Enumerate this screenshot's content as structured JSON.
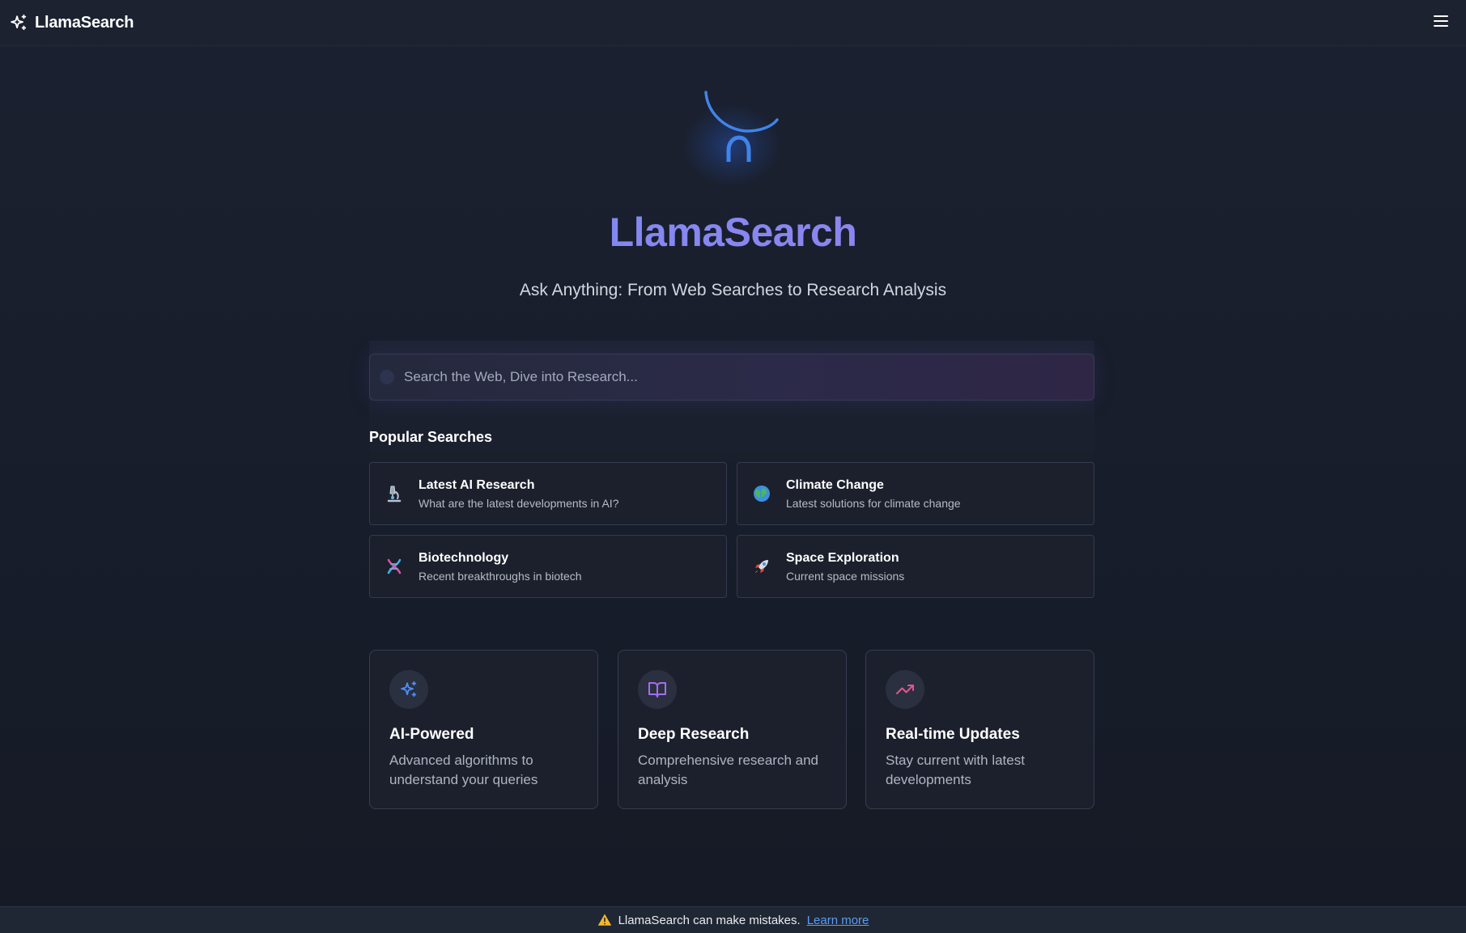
{
  "header": {
    "brand": "LlamaSearch",
    "brand_icon": "sparkles-icon",
    "menu_icon": "hamburger-menu-icon"
  },
  "hero": {
    "title": "LlamaSearch",
    "subtitle": "Ask Anything: From Web Searches to Research Analysis",
    "logo_icon": "llama-arc-logo"
  },
  "search": {
    "placeholder": "Search the Web, Dive into Research...",
    "value": ""
  },
  "popular": {
    "title": "Popular Searches",
    "items": [
      {
        "icon": "microscope-icon",
        "title": "Latest AI Research",
        "desc": "What are the latest developments in AI?"
      },
      {
        "icon": "globe-icon",
        "title": "Climate Change",
        "desc": "Latest solutions for climate change"
      },
      {
        "icon": "dna-icon",
        "title": "Biotechnology",
        "desc": "Recent breakthroughs in biotech"
      },
      {
        "icon": "rocket-icon",
        "title": "Space Exploration",
        "desc": "Current space missions"
      }
    ]
  },
  "features": [
    {
      "icon": "sparkles-icon",
      "title": "AI-Powered",
      "desc": "Advanced algorithms to understand your queries",
      "color": "#4f8ef7"
    },
    {
      "icon": "book-open-icon",
      "title": "Deep Research",
      "desc": "Comprehensive research and analysis",
      "color": "#a66cf0"
    },
    {
      "icon": "trending-up-icon",
      "title": "Real-time Updates",
      "desc": "Stay current with latest developments",
      "color": "#e8538f"
    }
  ],
  "footer": {
    "warning_icon": "warning-icon",
    "text": "LlamaSearch can make mistakes.",
    "link": "Learn more"
  },
  "colors": {
    "background": "#171c28",
    "accent_blue": "#4f8ef7",
    "title_gradient_start": "#6d8ff2",
    "title_gradient_end": "#9a7fe8",
    "link": "#5b9cf5"
  }
}
